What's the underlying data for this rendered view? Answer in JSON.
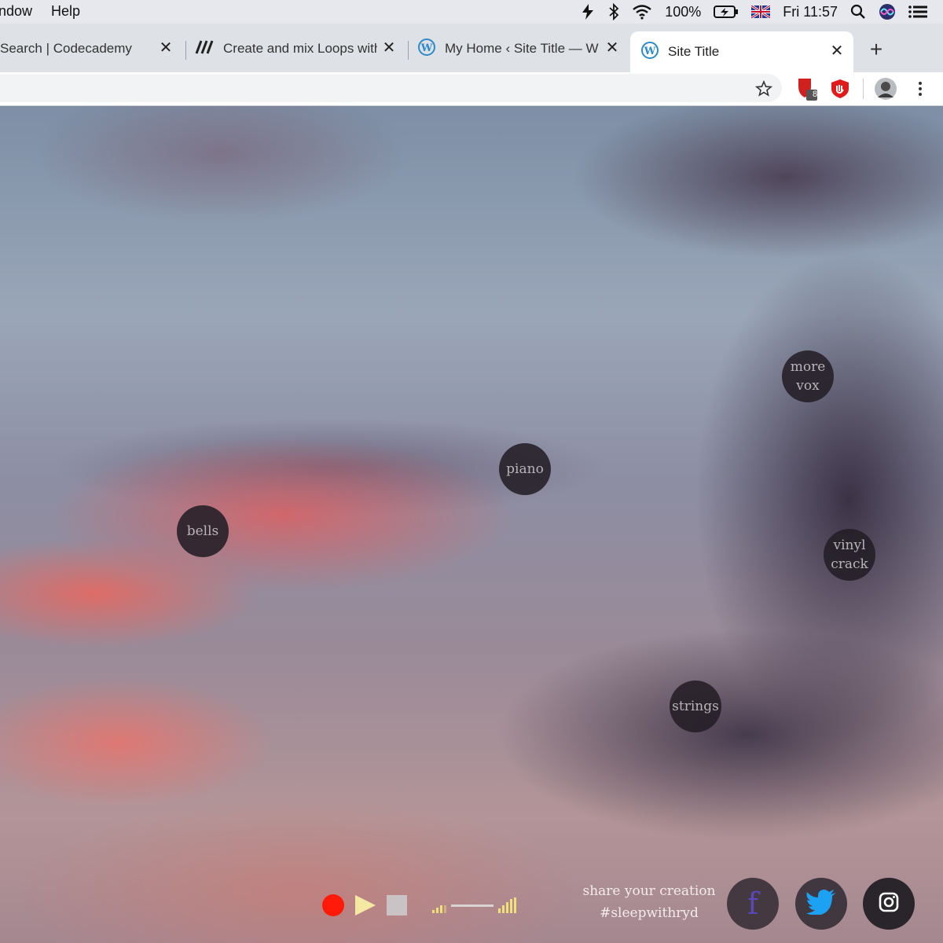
{
  "menubar": {
    "items": [
      "ndow",
      "Help"
    ],
    "battery": "100%",
    "clock": "Fri 11:57"
  },
  "tabs": [
    {
      "title": "Search | Codecademy",
      "close": "✕"
    },
    {
      "title": "Create and mix Loops with",
      "close": "✕"
    },
    {
      "title": "My Home ‹ Site Title — W",
      "close": "✕"
    },
    {
      "title": "Site Title",
      "close": "✕",
      "active": true
    }
  ],
  "newtab": "+",
  "extension_badge": "8",
  "sounds": {
    "more_vox": [
      "more",
      "vox"
    ],
    "piano": "piano",
    "bells": "bells",
    "vinyl_crack": [
      "vinyl",
      "crack"
    ],
    "strings": "strings"
  },
  "share": {
    "line1": "share your creation",
    "line2": "#sleepwithryd"
  },
  "social": {
    "facebook": "f"
  },
  "colors": {
    "record": "#ff1a0a",
    "play": "#f5e8a2",
    "volume": "#f0e07a",
    "facebook": "#4a3f8f",
    "twitter": "#1da1f2"
  }
}
